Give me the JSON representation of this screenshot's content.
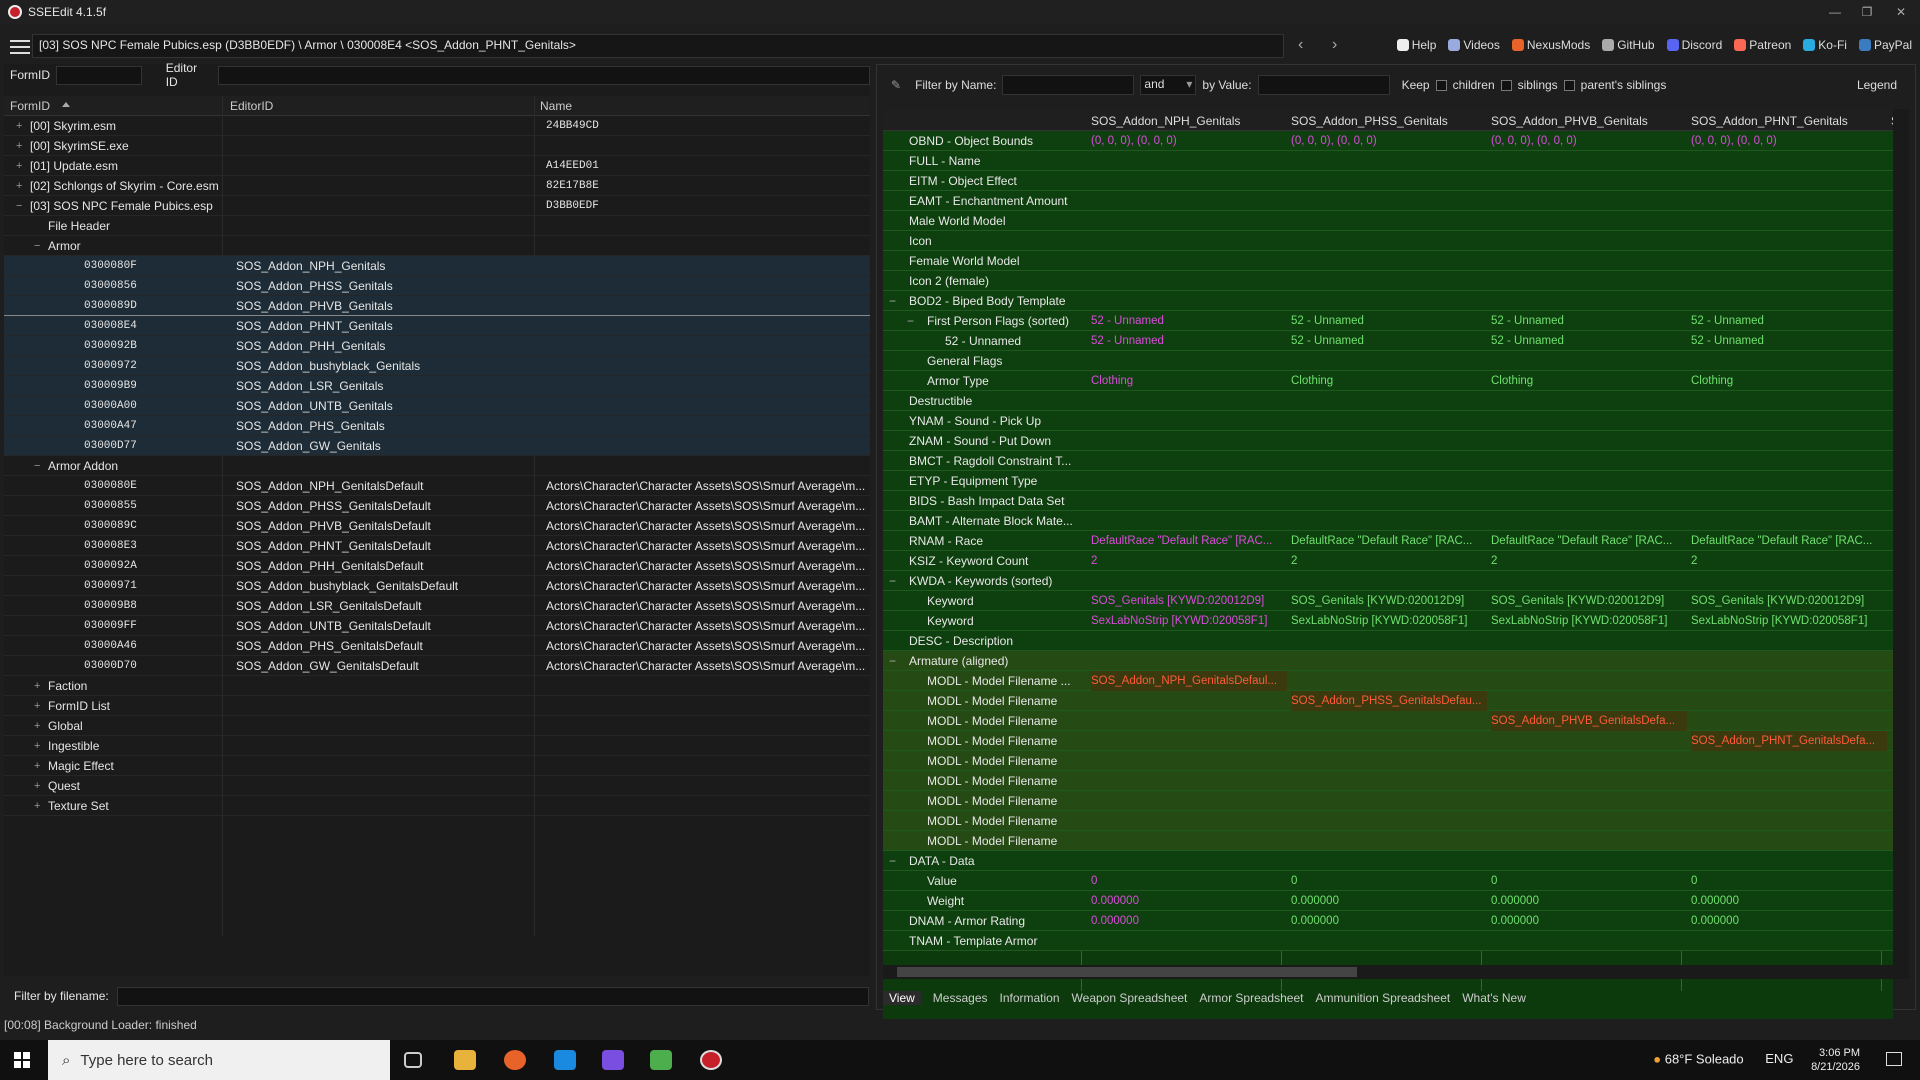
{
  "window": {
    "title": "SSEEdit 4.1.5f"
  },
  "toolbar": {
    "path": "[03] SOS NPC Female Pubics.esp (D3BB0EDF) \\ Armor \\ 030008E4 <SOS_Addon_PHNT_Genitals>",
    "links": [
      "Help",
      "Videos",
      "NexusMods",
      "GitHub",
      "Discord",
      "Patreon",
      "Ko-Fi",
      "PayPal"
    ]
  },
  "left": {
    "formid_label": "FormID",
    "editorid_label": "Editor ID",
    "headers": [
      "FormID",
      "EditorID",
      "Name"
    ],
    "filter_label": "Filter by filename:"
  },
  "tree": [
    {
      "d": 0,
      "e": "+",
      "a": "[00] Skyrim.esm",
      "b": "",
      "c": "24BB49CD"
    },
    {
      "d": 0,
      "e": "+",
      "a": "[00] SkyrimSE.exe",
      "b": "",
      "c": ""
    },
    {
      "d": 0,
      "e": "+",
      "a": "[01] Update.esm",
      "b": "",
      "c": "A14EED01"
    },
    {
      "d": 0,
      "e": "+",
      "a": "[02] Schlongs of Skyrim - Core.esm",
      "b": "",
      "c": "82E17B8E"
    },
    {
      "d": 0,
      "e": "-",
      "a": "[03] SOS NPC Female Pubics.esp",
      "b": "",
      "c": "D3BB0EDF"
    },
    {
      "d": 1,
      "e": "",
      "a": "File Header",
      "b": "",
      "c": ""
    },
    {
      "d": 1,
      "e": "-",
      "a": "Armor",
      "b": "",
      "c": ""
    },
    {
      "d": 2,
      "e": "",
      "a": "0300080F",
      "b": "SOS_Addon_NPH_Genitals",
      "c": "",
      "s": 1
    },
    {
      "d": 2,
      "e": "",
      "a": "03000856",
      "b": "SOS_Addon_PHSS_Genitals",
      "c": "",
      "s": 1
    },
    {
      "d": 2,
      "e": "",
      "a": "0300089D",
      "b": "SOS_Addon_PHVB_Genitals",
      "c": "",
      "s": 1
    },
    {
      "d": 2,
      "e": "",
      "a": "030008E4",
      "b": "SOS_Addon_PHNT_Genitals",
      "c": "",
      "s": 1
    },
    {
      "d": 2,
      "e": "",
      "a": "0300092B",
      "b": "SOS_Addon_PHH_Genitals",
      "c": "",
      "s": 1
    },
    {
      "d": 2,
      "e": "",
      "a": "03000972",
      "b": "SOS_Addon_bushyblack_Genitals",
      "c": "",
      "s": 1
    },
    {
      "d": 2,
      "e": "",
      "a": "030009B9",
      "b": "SOS_Addon_LSR_Genitals",
      "c": "",
      "s": 1
    },
    {
      "d": 2,
      "e": "",
      "a": "03000A00",
      "b": "SOS_Addon_UNTB_Genitals",
      "c": "",
      "s": 1
    },
    {
      "d": 2,
      "e": "",
      "a": "03000A47",
      "b": "SOS_Addon_PHS_Genitals",
      "c": "",
      "s": 1
    },
    {
      "d": 2,
      "e": "",
      "a": "03000D77",
      "b": "SOS_Addon_GW_Genitals",
      "c": "",
      "s": 1
    },
    {
      "d": 1,
      "e": "-",
      "a": "Armor Addon",
      "b": "",
      "c": ""
    },
    {
      "d": 2,
      "e": "",
      "a": "0300080E",
      "b": "SOS_Addon_NPH_GenitalsDefault",
      "c": "Actors\\Character\\Character Assets\\SOS\\Smurf Average\\m..."
    },
    {
      "d": 2,
      "e": "",
      "a": "03000855",
      "b": "SOS_Addon_PHSS_GenitalsDefault",
      "c": "Actors\\Character\\Character Assets\\SOS\\Smurf Average\\m..."
    },
    {
      "d": 2,
      "e": "",
      "a": "0300089C",
      "b": "SOS_Addon_PHVB_GenitalsDefault",
      "c": "Actors\\Character\\Character Assets\\SOS\\Smurf Average\\m..."
    },
    {
      "d": 2,
      "e": "",
      "a": "030008E3",
      "b": "SOS_Addon_PHNT_GenitalsDefault",
      "c": "Actors\\Character\\Character Assets\\SOS\\Smurf Average\\m..."
    },
    {
      "d": 2,
      "e": "",
      "a": "0300092A",
      "b": "SOS_Addon_PHH_GenitalsDefault",
      "c": "Actors\\Character\\Character Assets\\SOS\\Smurf Average\\m..."
    },
    {
      "d": 2,
      "e": "",
      "a": "03000971",
      "b": "SOS_Addon_bushyblack_GenitalsDefault",
      "c": "Actors\\Character\\Character Assets\\SOS\\Smurf Average\\m..."
    },
    {
      "d": 2,
      "e": "",
      "a": "030009B8",
      "b": "SOS_Addon_LSR_GenitalsDefault",
      "c": "Actors\\Character\\Character Assets\\SOS\\Smurf Average\\m..."
    },
    {
      "d": 2,
      "e": "",
      "a": "030009FF",
      "b": "SOS_Addon_UNTB_GenitalsDefault",
      "c": "Actors\\Character\\Character Assets\\SOS\\Smurf Average\\m..."
    },
    {
      "d": 2,
      "e": "",
      "a": "03000A46",
      "b": "SOS_Addon_PHS_GenitalsDefault",
      "c": "Actors\\Character\\Character Assets\\SOS\\Smurf Average\\m..."
    },
    {
      "d": 2,
      "e": "",
      "a": "03000D70",
      "b": "SOS_Addon_GW_GenitalsDefault",
      "c": "Actors\\Character\\Character Assets\\SOS\\Smurf Average\\m..."
    },
    {
      "d": 1,
      "e": "+",
      "a": "Faction",
      "b": "",
      "c": ""
    },
    {
      "d": 1,
      "e": "+",
      "a": "FormID List",
      "b": "",
      "c": ""
    },
    {
      "d": 1,
      "e": "+",
      "a": "Global",
      "b": "",
      "c": ""
    },
    {
      "d": 1,
      "e": "+",
      "a": "Ingestible",
      "b": "",
      "c": ""
    },
    {
      "d": 1,
      "e": "+",
      "a": "Magic Effect",
      "b": "",
      "c": ""
    },
    {
      "d": 1,
      "e": "+",
      "a": "Quest",
      "b": "",
      "c": ""
    },
    {
      "d": 1,
      "e": "+",
      "a": "Texture Set",
      "b": "",
      "c": ""
    }
  ],
  "right": {
    "filter_name_label": "Filter by Name:",
    "and_value": "and",
    "by_value_label": "by Value:",
    "keep_label": "Keep",
    "children": "children",
    "siblings": "siblings",
    "parents": "parent's siblings",
    "legend": "Legend",
    "columns": [
      "SOS_Addon_NPH_Genitals",
      "SOS_Addon_PHSS_Genitals",
      "SOS_Addon_PHVB_Genitals",
      "SOS_Addon_PHNT_Genitals",
      "SOS"
    ],
    "tabs": [
      "View",
      "Messages",
      "Information",
      "Weapon Spreadsheet",
      "Armor Spreadsheet",
      "Ammunition Spreadsheet",
      "What's New"
    ]
  },
  "grid": [
    {
      "l": "OBND - Object Bounds",
      "d": 0,
      "v": [
        "(0, 0, 0), (0, 0, 0)",
        "(0, 0, 0), (0, 0, 0)",
        "(0, 0, 0), (0, 0, 0)",
        "(0, 0, 0), (0, 0, 0)"
      ],
      "c": "pk"
    },
    {
      "l": "FULL - Name",
      "d": 0,
      "v": []
    },
    {
      "l": "EITM - Object Effect",
      "d": 0,
      "v": []
    },
    {
      "l": "EAMT - Enchantment Amount",
      "d": 0,
      "v": []
    },
    {
      "l": "Male World Model",
      "d": 0,
      "v": []
    },
    {
      "l": "Icon",
      "d": 0,
      "v": []
    },
    {
      "l": "Female World Model",
      "d": 0,
      "v": []
    },
    {
      "l": "Icon 2 (female)",
      "d": 0,
      "v": []
    },
    {
      "l": "BOD2 - Biped Body Template",
      "d": 0,
      "v": []
    },
    {
      "l": "First Person Flags (sorted)",
      "d": 1,
      "v": [
        "52 - Unnamed",
        "52 - Unnamed",
        "52 - Unnamed",
        "52 - Unnamed"
      ],
      "c": "mix"
    },
    {
      "l": "52 - Unnamed",
      "d": 2,
      "v": [
        "52 - Unnamed",
        "52 - Unnamed",
        "52 - Unnamed",
        "52 - Unnamed"
      ],
      "c": "mix"
    },
    {
      "l": "General Flags",
      "d": 1,
      "v": []
    },
    {
      "l": "Armor Type",
      "d": 1,
      "v": [
        "Clothing",
        "Clothing",
        "Clothing",
        "Clothing"
      ],
      "c": "mix"
    },
    {
      "l": "Destructible",
      "d": 0,
      "v": []
    },
    {
      "l": "YNAM - Sound - Pick Up",
      "d": 0,
      "v": []
    },
    {
      "l": "ZNAM - Sound - Put Down",
      "d": 0,
      "v": []
    },
    {
      "l": "BMCT - Ragdoll Constraint T...",
      "d": 0,
      "v": []
    },
    {
      "l": "ETYP - Equipment Type",
      "d": 0,
      "v": []
    },
    {
      "l": "BIDS - Bash Impact Data Set",
      "d": 0,
      "v": []
    },
    {
      "l": "BAMT - Alternate Block Mate...",
      "d": 0,
      "v": []
    },
    {
      "l": "RNAM - Race",
      "d": 0,
      "v": [
        "DefaultRace \"Default Race\" [RAC...",
        "DefaultRace \"Default Race\" [RAC...",
        "DefaultRace \"Default Race\" [RAC...",
        "DefaultRace \"Default Race\" [RAC..."
      ],
      "c": "mix"
    },
    {
      "l": "KSIZ - Keyword Count",
      "d": 0,
      "v": [
        "2",
        "2",
        "2",
        "2"
      ],
      "c": "mix"
    },
    {
      "l": "KWDA - Keywords (sorted)",
      "d": 0,
      "v": []
    },
    {
      "l": "Keyword",
      "d": 1,
      "v": [
        "SOS_Genitals [KYWD:020012D9]",
        "SOS_Genitals [KYWD:020012D9]",
        "SOS_Genitals [KYWD:020012D9]",
        "SOS_Genitals [KYWD:020012D9]"
      ],
      "c": "mix"
    },
    {
      "l": "Keyword",
      "d": 1,
      "v": [
        "SexLabNoStrip [KYWD:020058F1]",
        "SexLabNoStrip [KYWD:020058F1]",
        "SexLabNoStrip [KYWD:020058F1]",
        "SexLabNoStrip [KYWD:020058F1]"
      ],
      "c": "mix"
    },
    {
      "l": "DESC - Description",
      "d": 0,
      "v": []
    },
    {
      "l": "Armature (aligned)",
      "d": 0,
      "v": [],
      "alt": 1
    },
    {
      "l": "MODL - Model Filename ...",
      "d": 1,
      "v": [
        "SOS_Addon_NPH_GenitalsDefaul...",
        "",
        "",
        ""
      ],
      "c": "rd",
      "alt": 1
    },
    {
      "l": "MODL - Model Filename",
      "d": 1,
      "v": [
        "",
        "SOS_Addon_PHSS_GenitalsDefau...",
        "",
        ""
      ],
      "c": "rd",
      "alt": 1
    },
    {
      "l": "MODL - Model Filename",
      "d": 1,
      "v": [
        "",
        "",
        "SOS_Addon_PHVB_GenitalsDefa...",
        ""
      ],
      "c": "rd",
      "alt": 1
    },
    {
      "l": "MODL - Model Filename",
      "d": 1,
      "v": [
        "",
        "",
        "",
        "SOS_Addon_PHNT_GenitalsDefa..."
      ],
      "c": "rd",
      "alt": 1
    },
    {
      "l": "MODL - Model Filename",
      "d": 1,
      "v": [],
      "alt": 1
    },
    {
      "l": "MODL - Model Filename",
      "d": 1,
      "v": [],
      "alt": 1
    },
    {
      "l": "MODL - Model Filename",
      "d": 1,
      "v": [],
      "alt": 1
    },
    {
      "l": "MODL - Model Filename",
      "d": 1,
      "v": [],
      "alt": 1
    },
    {
      "l": "MODL - Model Filename",
      "d": 1,
      "v": [],
      "alt": 1
    },
    {
      "l": "DATA - Data",
      "d": 0,
      "v": []
    },
    {
      "l": "Value",
      "d": 1,
      "v": [
        "0",
        "0",
        "0",
        "0"
      ],
      "c": "mix"
    },
    {
      "l": "Weight",
      "d": 1,
      "v": [
        "0.000000",
        "0.000000",
        "0.000000",
        "0.000000"
      ],
      "c": "mix"
    },
    {
      "l": "DNAM - Armor Rating",
      "d": 0,
      "v": [
        "0.000000",
        "0.000000",
        "0.000000",
        "0.000000"
      ],
      "c": "mix"
    },
    {
      "l": "TNAM - Template Armor",
      "d": 0,
      "v": []
    }
  ],
  "status": "[00:08] Background Loader: finished",
  "taskbar": {
    "search": "Type here to search",
    "weather": "68°F Soleado",
    "lang": "ENG",
    "time": "3:06 PM",
    "date": "8/21/2026"
  }
}
